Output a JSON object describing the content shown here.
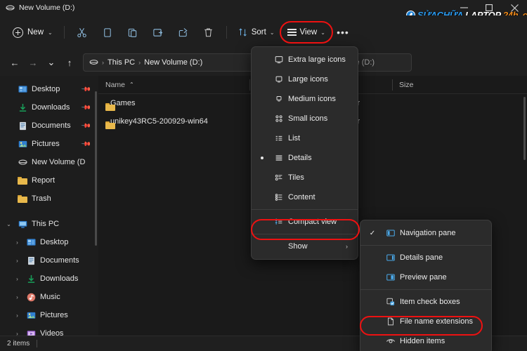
{
  "window": {
    "tab_title": "New Volume (D:)",
    "tab_icon": "drive-icon",
    "minimize": "—",
    "maximize": "☐",
    "close": "✕"
  },
  "watermark": {
    "part1": "SỬACHỮA",
    "part2": "LAPTOP",
    "part3": "24h",
    "part4": ".com"
  },
  "toolbar": {
    "new_label": "New",
    "new_chevron": "⌄",
    "cut_title": "Cut",
    "copy_title": "Copy",
    "paste_title": "Paste",
    "rename_title": "Rename",
    "share_title": "Share",
    "delete_title": "Delete",
    "sort_label": "Sort",
    "sort_chevron": "⌄",
    "view_label": "View",
    "view_chevron": "⌄",
    "more_label": "•••"
  },
  "navbar": {
    "back": "←",
    "forward": "→",
    "recent": "⌄",
    "up": "↑",
    "breadcrumb": [
      {
        "label": "",
        "icon": "drive-icon"
      },
      {
        "label": "This PC",
        "icon": ""
      },
      {
        "label": "New Volume (D:)",
        "icon": ""
      }
    ],
    "separator": "›",
    "search_placeholder": "Search New Volume (D:)"
  },
  "sidebar": {
    "quick_access": [
      {
        "label": "Desktop",
        "icon": "desktop-icon",
        "pinned": true,
        "expand": ""
      },
      {
        "label": "Downloads",
        "icon": "downloads-icon",
        "pinned": true,
        "expand": ""
      },
      {
        "label": "Documents",
        "icon": "documents-icon",
        "pinned": true,
        "expand": ""
      },
      {
        "label": "Pictures",
        "icon": "pictures-icon",
        "pinned": true,
        "expand": ""
      },
      {
        "label": "New Volume (D",
        "icon": "drive-icon",
        "pinned": false,
        "expand": ""
      },
      {
        "label": "Report",
        "icon": "folder-icon",
        "pinned": false,
        "expand": ""
      },
      {
        "label": "Trash",
        "icon": "folder-icon",
        "pinned": false,
        "expand": ""
      }
    ],
    "this_pc": {
      "label": "This PC",
      "icon": "thispc-icon",
      "expand": "⌄",
      "children": [
        {
          "label": "Desktop",
          "icon": "desktop-icon",
          "expand": "›"
        },
        {
          "label": "Documents",
          "icon": "documents-icon",
          "expand": "›"
        },
        {
          "label": "Downloads",
          "icon": "downloads-icon",
          "expand": "›"
        },
        {
          "label": "Music",
          "icon": "music-icon",
          "expand": "›"
        },
        {
          "label": "Pictures",
          "icon": "pictures-icon",
          "expand": "›"
        },
        {
          "label": "Videos",
          "icon": "videos-icon",
          "expand": "›"
        }
      ]
    }
  },
  "filelist": {
    "columns": [
      {
        "label": "Name",
        "sorted": true,
        "caret": "⌃"
      },
      {
        "label": "",
        "sorted": false,
        "caret": ""
      },
      {
        "label": "",
        "sorted": false,
        "caret": ""
      },
      {
        "label": "Size",
        "sorted": false,
        "caret": ""
      }
    ],
    "rows": [
      {
        "name": "Games",
        "icon": "folder-icon",
        "type": "ler",
        "size": ""
      },
      {
        "name": "unikey43RC5-200929-win64",
        "icon": "folder-icon",
        "type": "ler",
        "size": ""
      }
    ]
  },
  "statusbar": {
    "item_count": "2 items"
  },
  "view_menu": {
    "items": [
      {
        "label": "Extra large icons",
        "icon": "extra-large-icons-icon",
        "selected": false
      },
      {
        "label": "Large icons",
        "icon": "large-icons-icon",
        "selected": false
      },
      {
        "label": "Medium icons",
        "icon": "medium-icons-icon",
        "selected": false
      },
      {
        "label": "Small icons",
        "icon": "small-icons-icon",
        "selected": false
      },
      {
        "label": "List",
        "icon": "list-icon",
        "selected": false
      },
      {
        "label": "Details",
        "icon": "details-icon",
        "selected": true
      },
      {
        "label": "Tiles",
        "icon": "tiles-icon",
        "selected": false
      },
      {
        "label": "Content",
        "icon": "content-icon",
        "selected": false
      }
    ],
    "compact": {
      "label": "Compact view",
      "icon": "compact-view-icon"
    },
    "show": {
      "label": "Show",
      "arrow": "›",
      "highlighted": true
    }
  },
  "show_menu": {
    "items": [
      {
        "label": "Navigation pane",
        "icon": "navigation-pane-icon",
        "checked": true,
        "check": "✓"
      },
      {
        "label": "Details pane",
        "icon": "details-pane-icon",
        "checked": false,
        "check": ""
      },
      {
        "label": "Preview pane",
        "icon": "preview-pane-icon",
        "checked": false,
        "check": ""
      },
      {
        "label": "Item check boxes",
        "icon": "item-check-boxes-icon",
        "checked": false,
        "check": ""
      },
      {
        "label": "File name extensions",
        "icon": "file-name-extensions-icon",
        "checked": false,
        "check": ""
      },
      {
        "label": "Hidden items",
        "icon": "hidden-items-icon",
        "checked": false,
        "check": ""
      }
    ]
  },
  "annotations": {
    "color": "#ee1111",
    "targets": [
      "View button",
      "Show menu item",
      "Hidden items menu item"
    ]
  }
}
